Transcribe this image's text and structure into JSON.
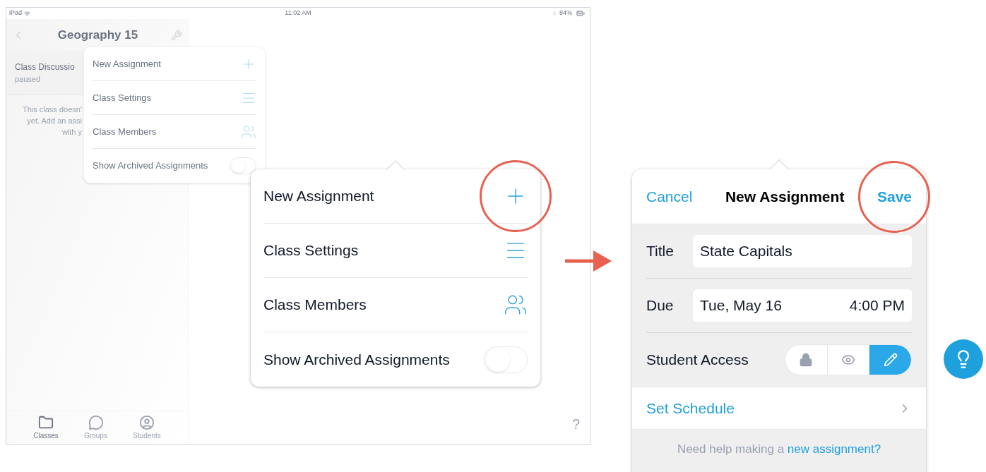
{
  "ipad": {
    "status_bar": {
      "carrier": "iPad",
      "time": "11:02 AM",
      "battery": "84%"
    },
    "sidebar": {
      "title": "Geography 15",
      "items": [
        {
          "title": "Class Discussio",
          "subtitle": "paused"
        }
      ],
      "empty_text": [
        "This class doesn'",
        "yet. Add an assi",
        "with y"
      ],
      "tabs": [
        {
          "kind": "folder",
          "label": "Classes",
          "selected": true
        },
        {
          "kind": "chat",
          "label": "Groups",
          "selected": false
        },
        {
          "kind": "person",
          "label": "Students",
          "selected": false
        }
      ]
    },
    "help": "?",
    "menu": {
      "items": [
        {
          "kind": "add",
          "label": "New Assignment"
        },
        {
          "kind": "settings",
          "label": "Class Settings"
        },
        {
          "kind": "members",
          "label": "Class Members"
        },
        {
          "kind": "toggle",
          "label": "Show Archived Assignments",
          "on": false
        }
      ]
    }
  },
  "zoomed_menu": {
    "items": [
      {
        "kind": "add",
        "label": "New Assignment",
        "circled": true
      },
      {
        "kind": "settings",
        "label": "Class Settings",
        "circled": false
      },
      {
        "kind": "members",
        "label": "Class Members",
        "circled": false
      },
      {
        "kind": "toggle",
        "label": "Show Archived Assignments",
        "on": false,
        "circled": false
      }
    ]
  },
  "form": {
    "cancel": "Cancel",
    "title": "New Assignment",
    "save": {
      "label": "Save",
      "circled": true
    },
    "fields": [
      {
        "kind": "text",
        "label": "Title",
        "value": "State Capitals"
      },
      {
        "kind": "date",
        "label": "Due",
        "value": "Tue, May 16",
        "time": "4:00 PM"
      },
      {
        "kind": "access",
        "label": "Student Access",
        "options": [
          {
            "kind": "lock",
            "selected": false
          },
          {
            "kind": "view",
            "selected": false
          },
          {
            "kind": "edit",
            "selected": true
          }
        ]
      }
    ],
    "schedule": "Set Schedule",
    "help_text": "Need help making a ",
    "help_link": "new assignment?"
  }
}
